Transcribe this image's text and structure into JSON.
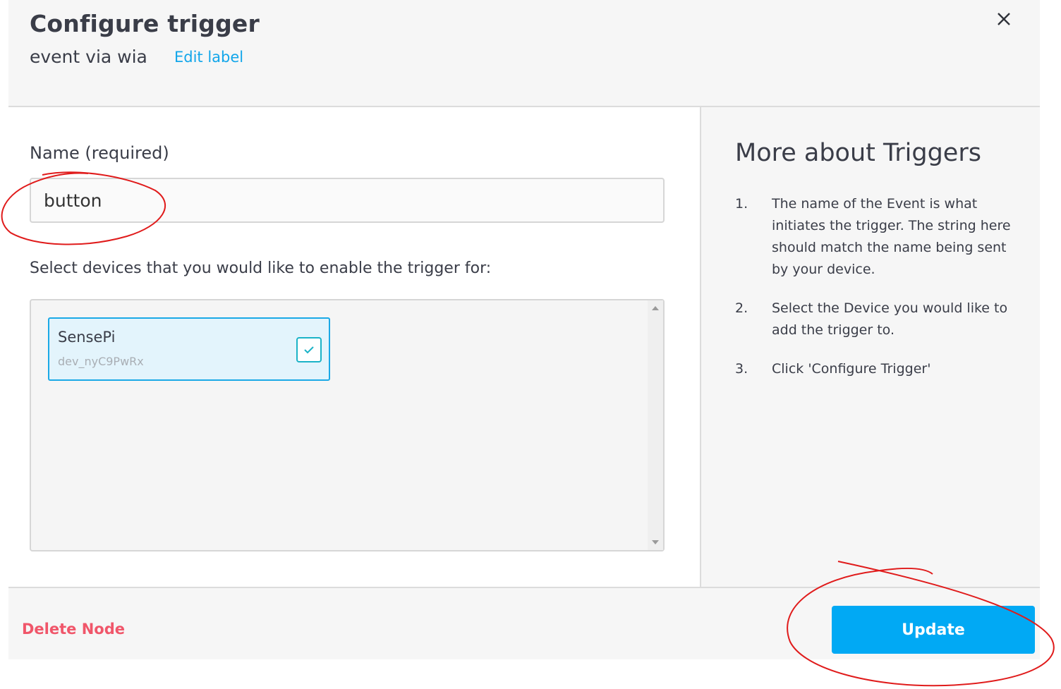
{
  "header": {
    "title": "Configure trigger",
    "subtitle": "event via wia",
    "edit_label": "Edit label"
  },
  "form": {
    "name_label": "Name (required)",
    "name_value": "button",
    "devices_label": "Select devices that you would like to enable the trigger for:",
    "devices": [
      {
        "name": "SensePi",
        "id": "dev_nyC9PwRx",
        "selected": true
      }
    ]
  },
  "info": {
    "title": "More about Triggers",
    "steps": [
      {
        "num": "1.",
        "text": "The name of the Event is what initiates the trigger. The string here should match the name being sent by your device."
      },
      {
        "num": "2.",
        "text": "Select the Device you would like to add the trigger to."
      },
      {
        "num": "3.",
        "text": "Click 'Configure Trigger'"
      }
    ]
  },
  "footer": {
    "delete_label": "Delete Node",
    "update_label": "Update"
  },
  "colors": {
    "accent": "#01a9f4",
    "link": "#12a6ea",
    "danger": "#f0566a",
    "annotation": "#e01b1b"
  }
}
